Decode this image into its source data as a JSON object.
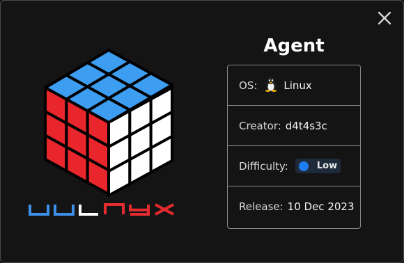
{
  "machine": {
    "title": "Agent",
    "brand": "VULNYX",
    "os_label": "OS:",
    "os_value": "Linux",
    "os_icon": "linux-tux-icon",
    "creator_label": "Creator:",
    "creator_value": "d4t4s3c",
    "difficulty_label": "Difficulty:",
    "difficulty_value": "Low",
    "release_label": "Release:",
    "release_value": "10 Dec 2023"
  },
  "colors": {
    "difficulty_dot": "#1e7cf0",
    "cube_top": "#3d9df0",
    "cube_left": "#e8262b",
    "cube_right": "#ffffff",
    "brand_blue": "#3d8fe8",
    "brand_white": "#ffffff",
    "brand_red": "#e62b30"
  }
}
